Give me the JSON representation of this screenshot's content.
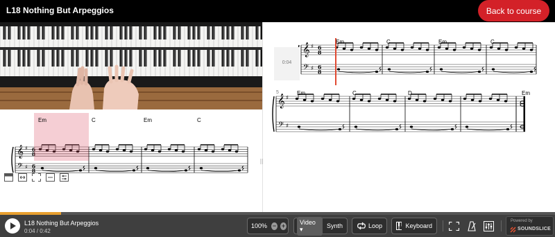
{
  "header": {
    "title": "L18 Nothing But Arpeggios",
    "back_button": "Back to course",
    "accent": "#d32128"
  },
  "left_score": {
    "chords": [
      "Em",
      "C",
      "Em",
      "C"
    ]
  },
  "right_score": {
    "time_label": "0:04",
    "system1_chords": [
      "Em",
      "C",
      "Em",
      "C"
    ],
    "system2_number": "5",
    "system2_chords": [
      "Em",
      "C",
      "D",
      "Em"
    ]
  },
  "toolbar": {
    "icons": [
      "layout-icon",
      "fit-width-icon",
      "fullscreen-icon",
      "collapse-icon",
      "settings-icon"
    ]
  },
  "player": {
    "title": "L18 Nothing But Arpeggios",
    "time": "0:04 / 0:42",
    "progress_fraction": 0.11,
    "zoom": "100%",
    "zoom_out": "−",
    "zoom_in": "+",
    "source": "Video",
    "synth": "Synth",
    "loop": "Loop",
    "keyboard": "Keyboard",
    "powered_by": "Powered by",
    "brand": "SOUNDSLICE"
  }
}
